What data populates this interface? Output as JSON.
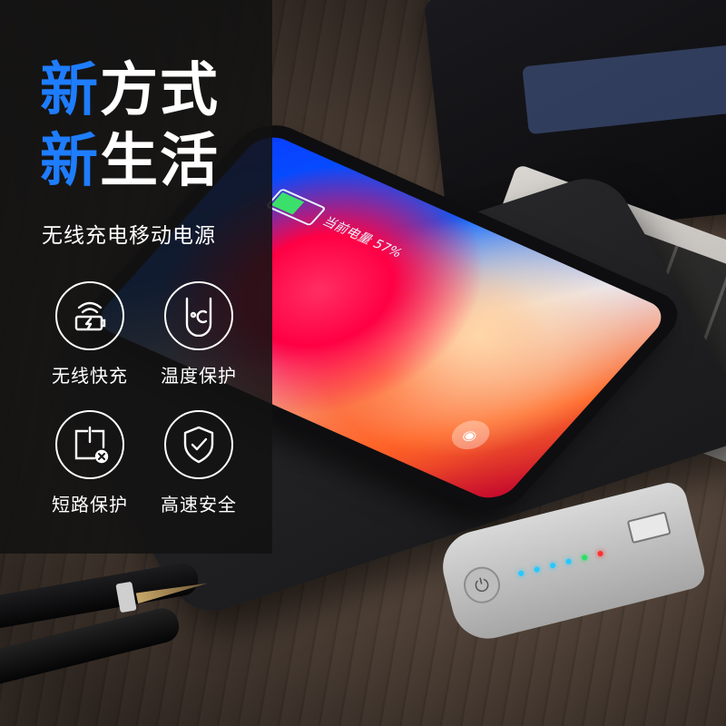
{
  "promo": {
    "headline_line1_blue": "新",
    "headline_line1_white": "方式",
    "headline_line2_blue": "新",
    "headline_line2_white": "生活",
    "subtitle": "无线充电移动电源"
  },
  "features": [
    {
      "label": "无线快充",
      "icon": "wireless-charging-icon"
    },
    {
      "label": "温度保护",
      "icon": "temperature-icon"
    },
    {
      "label": "短路保护",
      "icon": "short-circuit-icon"
    },
    {
      "label": "高速安全",
      "icon": "shield-check-icon"
    }
  ],
  "phone": {
    "battery_text": "当前电量 57%",
    "battery_level": 57
  },
  "colors": {
    "accent_blue": "#1e7dff",
    "panel": "#121212",
    "text": "#ffffff"
  }
}
